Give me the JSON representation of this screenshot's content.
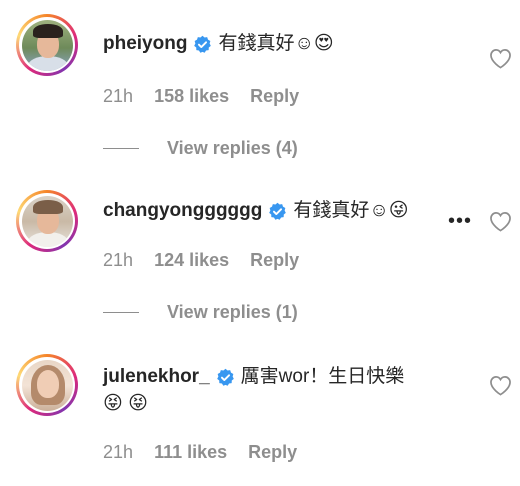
{
  "comments": [
    {
      "username": "pheiyong",
      "text": "有錢真好☺😍",
      "time": "21h",
      "likes": "158 likes",
      "reply": "Reply",
      "view_replies": "View replies (4)"
    },
    {
      "username": "changyongggggg",
      "text": "有錢真好☺😜",
      "more": "•••",
      "time": "21h",
      "likes": "124 likes",
      "reply": "Reply",
      "view_replies": "View replies (1)"
    },
    {
      "username": "julenekhor_",
      "text": "厲害wor！生日快樂",
      "text_line2": "😝 😝",
      "time": "21h",
      "likes": "111 likes",
      "reply": "Reply"
    }
  ],
  "colors": {
    "text": "#262626",
    "meta": "#8e8e8e",
    "verified": "#3897f0",
    "background": "#ffffff"
  }
}
